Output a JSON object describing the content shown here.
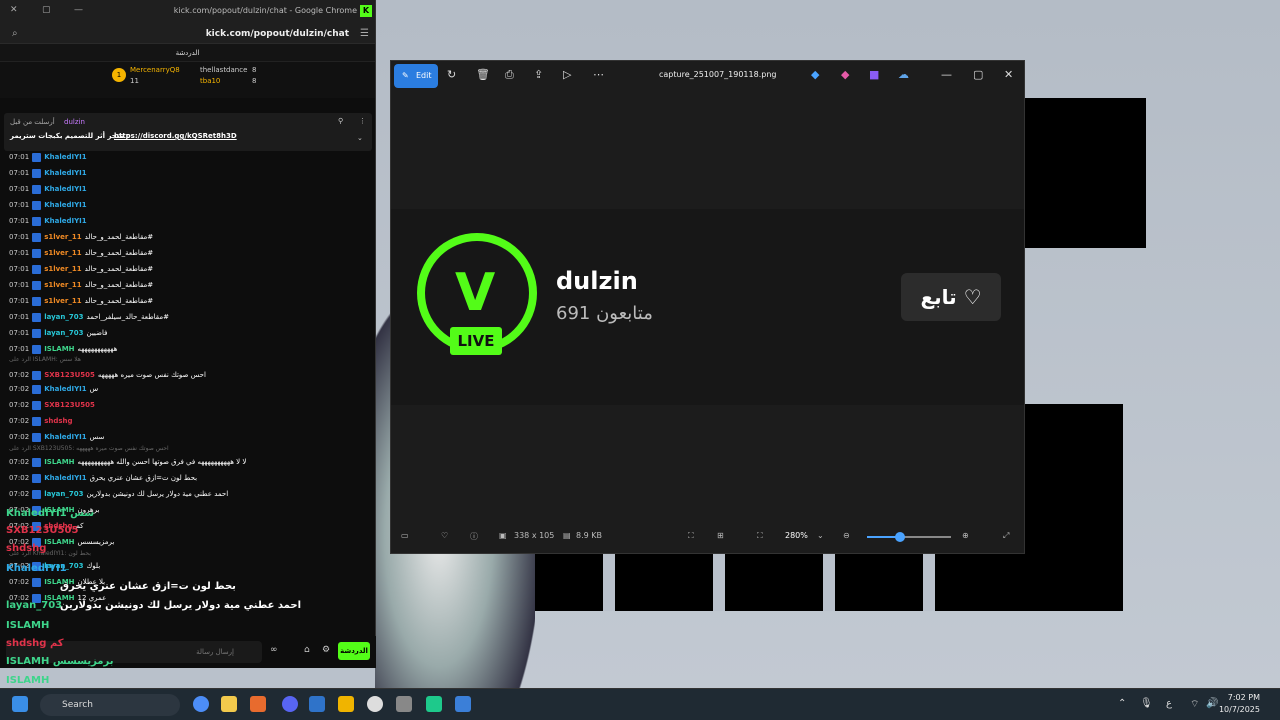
{
  "browser": {
    "title": "kick.com/popout/dulzin/chat - Google Chrome",
    "address": "kick.com/popout/dulzin/chat"
  },
  "chat": {
    "header": "الدردشة",
    "gifters": [
      {
        "rank": "1",
        "name": "MercenarryQ8",
        "count": "11"
      },
      {
        "name": "thellastdance",
        "count": "8"
      },
      {
        "name": "tba10",
        "count": "8"
      }
    ],
    "pinned": {
      "by": "dulzin",
      "note": "أرسلت من قبل",
      "text": "متجر أثر للتصميم بكبجات ستريمر :",
      "link": "https://discord.gg/kQSRet8h3D"
    },
    "messages": [
      {
        "time": "07:01",
        "user": "KhaledIYI1",
        "text": ""
      },
      {
        "time": "07:01",
        "user": "KhaledIYI1",
        "text": ""
      },
      {
        "time": "07:01",
        "user": "KhaledIYI1",
        "text": ""
      },
      {
        "time": "07:01",
        "user": "KhaledIYI1",
        "text": ""
      },
      {
        "time": "07:01",
        "user": "KhaledIYI1",
        "text": ""
      },
      {
        "time": "07:01",
        "user": "s1lver_11",
        "text": "مقاطعة_لحمد_و_حالد#"
      },
      {
        "time": "07:01",
        "user": "s1lver_11",
        "text": "مقاطعة_لحمد_و_حالد#"
      },
      {
        "time": "07:01",
        "user": "s1lver_11",
        "text": "مقاطعة_لحمد_و_حالد#"
      },
      {
        "time": "07:01",
        "user": "s1lver_11",
        "text": "مقاطعة_لحمد_و_حالد#"
      },
      {
        "time": "07:01",
        "user": "s1lver_11",
        "text": "مقاطعة_لحمد_و_حالد#"
      },
      {
        "time": "07:01",
        "user": "layan_703",
        "text": "مقاطعة_حالد_سيلفر_احمد#"
      },
      {
        "time": "07:01",
        "user": "layan_703",
        "text": "فاضيين"
      },
      {
        "time": "07:01",
        "user": "ISLAMH",
        "text": "هههههههههههه"
      },
      {
        "time": "07:02",
        "user": "SXB123U505",
        "text": "احس صوتك نفس صوت ميره هههههه"
      },
      {
        "time": "07:02",
        "user": "KhaledIYI1",
        "text": "س"
      },
      {
        "time": "07:02",
        "user": "SXB123U505",
        "text": ""
      },
      {
        "time": "07:02",
        "user": "shdshg",
        "text": ""
      },
      {
        "time": "07:02",
        "user": "KhaledIYI1",
        "text": "سس"
      },
      {
        "time": "07:02",
        "user": "ISLAMH",
        "text": "لا لا ههههههههههه في فرق صوتها احسن والله ههههههههههه"
      },
      {
        "time": "07:02",
        "user": "KhaledIYI1",
        "text": "بحط لون ت=ازق عشان عنري يحرق"
      },
      {
        "time": "07:02",
        "user": "layan_703",
        "text": "احمد عطني مية دولار يرسل لك دونيشن بدولارين"
      },
      {
        "time": "07:02",
        "user": "ISLAMH",
        "text": "برهرون"
      },
      {
        "time": "07:02",
        "user": "shdshg",
        "text": "كم"
      },
      {
        "time": "07:02",
        "user": "ISLAMH",
        "text": "برمزيسسس"
      },
      {
        "time": "07:02",
        "user": "layan_703",
        "text": "بلوك"
      },
      {
        "time": "07:02",
        "user": "ISLAMH",
        "text": "بلا عطلان"
      },
      {
        "time": "07:02",
        "user": "ISLAMH",
        "text": "عمري 12"
      }
    ],
    "replies": [
      "الرد على ISLAMH: هلا سس",
      "الرد على SXB123U505: احس صوتك نفس صوت ميره هههههه",
      "الرد على KhaledIYI1: بحط لون"
    ],
    "overlay": [
      "KhaledIYI1 سس",
      "SXB123U505",
      "shdshg",
      "KhaledIYI1",
      "بحط لون ت=ازق عشان عنري يحرق",
      "layan_703",
      "احمد عطني مية دولار يرسل لك دونيشن بدولارين",
      "ISLAMH",
      "shdshg كم",
      "ISLAMH برمزيسسس",
      "ISLAMH"
    ],
    "input_placeholder": "إرسال رسالة",
    "send_label": "الدردشة"
  },
  "photos": {
    "filename": "capture_251007_190118.png",
    "edit_label": "Edit",
    "channel_name": "dulzin",
    "followers": "691 متابعون",
    "live": "LIVE",
    "follow_btn": "تابع",
    "dimensions": "338 x 105",
    "filesize": "8.9 KB",
    "zoom": "280%"
  },
  "taskbar": {
    "search": "Search",
    "time": "7:02 PM",
    "date": "10/7/2025",
    "lang": "ع"
  }
}
